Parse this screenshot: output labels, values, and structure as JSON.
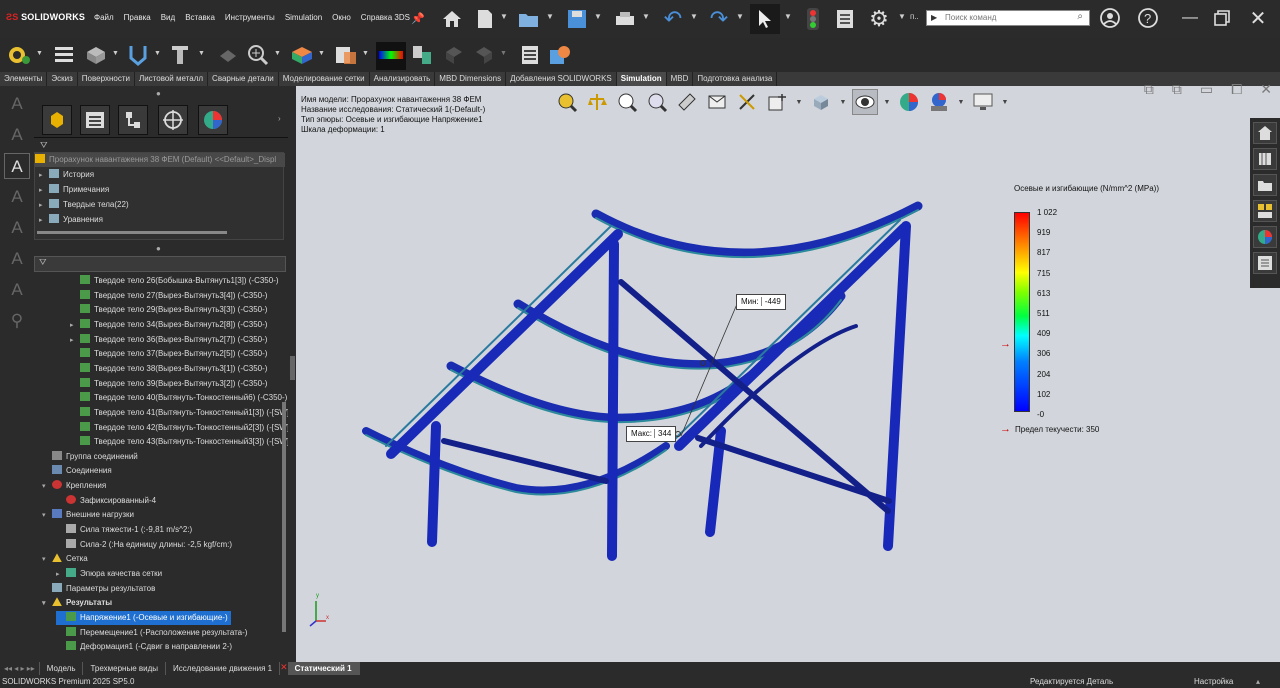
{
  "app": {
    "logo_text": "SOLIDWORKS"
  },
  "menu": [
    "Файл",
    "Правка",
    "Вид",
    "Вставка",
    "Инструменты",
    "Simulation",
    "Окно",
    "Справка 3DS"
  ],
  "top_toolbar": {
    "cut_label": "п..",
    "search_placeholder": "Поиск команд"
  },
  "tabs": [
    {
      "label": "Элементы",
      "active": false
    },
    {
      "label": "Эскиз",
      "active": false
    },
    {
      "label": "Поверхности",
      "active": false
    },
    {
      "label": "Листовой металл",
      "active": false
    },
    {
      "label": "Сварные детали",
      "active": false
    },
    {
      "label": "Моделирование сетки",
      "active": false
    },
    {
      "label": "Анализировать",
      "active": false
    },
    {
      "label": "MBD Dimensions",
      "active": false
    },
    {
      "label": "Добавления SOLIDWORKS",
      "active": false
    },
    {
      "label": "Simulation",
      "active": true
    },
    {
      "label": "MBD",
      "active": false
    },
    {
      "label": "Подготовка анализа",
      "active": false
    }
  ],
  "feature_tree_top": {
    "root": "Прорахунок навантаження 38 ФЕМ (Default) <<Default>_Displ",
    "items": [
      "История",
      "Примечания",
      "Твердые тела(22)",
      "Уравнения"
    ]
  },
  "feature_tree_bottom": {
    "items": [
      {
        "label": "Твердое тело 26(Бобышка-Вытянуть1[3]) (-C350-)",
        "indent": 3,
        "icon": "body",
        "arrow": false
      },
      {
        "label": "Твердое тело 27(Вырез-Вытянуть3[4]) (-C350-)",
        "indent": 3,
        "icon": "body",
        "arrow": false
      },
      {
        "label": "Твердое тело 29(Вырез-Вытянуть3[3]) (-C350-)",
        "indent": 3,
        "icon": "body",
        "arrow": false
      },
      {
        "label": "Твердое тело 34(Вырез-Вытянуть2[8]) (-C350-)",
        "indent": 3,
        "icon": "body",
        "arrow": true
      },
      {
        "label": "Твердое тело 36(Вырез-Вытянуть2[7]) (-C350-)",
        "indent": 3,
        "icon": "body",
        "arrow": true
      },
      {
        "label": "Твердое тело 37(Вырез-Вытянуть2[5]) (-C350-)",
        "indent": 3,
        "icon": "body",
        "arrow": false
      },
      {
        "label": "Твердое тело 38(Вырез-Вытянуть3[1]) (-C350-)",
        "indent": 3,
        "icon": "body",
        "arrow": false
      },
      {
        "label": "Твердое тело 39(Вырез-Вытянуть3[2]) (-C350-)",
        "indent": 3,
        "icon": "body",
        "arrow": false
      },
      {
        "label": "Твердое тело 40(Вытянуть-Тонкостенный6) (-C350-)",
        "indent": 3,
        "icon": "body",
        "arrow": false
      },
      {
        "label": "Твердое тело 41(Вытянуть-Тонкостенный1[3]) (-[SW]",
        "indent": 3,
        "icon": "body",
        "arrow": false
      },
      {
        "label": "Твердое тело 42(Вытянуть-Тонкостенный2[3]) (-[SW]",
        "indent": 3,
        "icon": "body",
        "arrow": false
      },
      {
        "label": "Твердое тело 43(Вытянуть-Тонкостенный3[3]) (-[SW]",
        "indent": 3,
        "icon": "body",
        "arrow": false
      },
      {
        "label": "Группа соединений",
        "indent": 1,
        "icon": "group",
        "arrow": false
      },
      {
        "label": "Соединения",
        "indent": 1,
        "icon": "conn",
        "arrow": false
      },
      {
        "label": "Крепления",
        "indent": 1,
        "icon": "fix",
        "arrow": true
      },
      {
        "label": "Зафиксированный-4",
        "indent": 2,
        "icon": "fixred",
        "arrow": false
      },
      {
        "label": "Внешние нагрузки",
        "indent": 1,
        "icon": "load",
        "arrow": true
      },
      {
        "label": "Сила тяжести-1 (:-9,81 m/s^2:)",
        "indent": 2,
        "icon": "grav",
        "arrow": false
      },
      {
        "label": "Сила-2 (:На единицу длины: -2,5 kgf/cm:)",
        "indent": 2,
        "icon": "force",
        "arrow": false
      },
      {
        "label": "Сетка",
        "indent": 1,
        "icon": "warn",
        "arrow": true
      },
      {
        "label": "Эпюра качества сетки",
        "indent": 2,
        "icon": "plot",
        "arrow": true
      },
      {
        "label": "Параметры результатов",
        "indent": 1,
        "icon": "params",
        "arrow": false
      },
      {
        "label": "Результаты",
        "indent": 1,
        "icon": "warn",
        "arrow": true,
        "bold": true
      },
      {
        "label": "Напряжение1 (-Осевые и изгибающие-)",
        "indent": 2,
        "icon": "res",
        "arrow": false,
        "selected": true
      },
      {
        "label": "Перемещение1 (-Расположение результата-)",
        "indent": 2,
        "icon": "res",
        "arrow": false
      },
      {
        "label": "Деформация1 (-Сдвиг в направлении 2-)",
        "indent": 2,
        "icon": "res",
        "arrow": false
      }
    ]
  },
  "model_info": [
    "Имя модели: Прорахунок навантаження 38 ФЕМ",
    "Название исследования: Статический 1(-Default-)",
    "Тип эпюры: Осевые и изгибающие Напряжение1",
    "Шкала деформации: 1"
  ],
  "legend": {
    "title": "Осевые и изгибающие (N/mm^2 (MPa))",
    "ticks": [
      "1 022",
      "919",
      "817",
      "715",
      "613",
      "511",
      "409",
      "306",
      "204",
      "102",
      "-0"
    ],
    "yield_label": "Предел текучести: 350"
  },
  "probes": {
    "min_label": "Мин:",
    "min_value": "-449",
    "max_label": "Макс:",
    "max_value": "344"
  },
  "axes_triad": {
    "x": "x",
    "y": "y"
  },
  "bottom_tabs": [
    {
      "label": "Модель",
      "active": false
    },
    {
      "label": "Трехмерные виды",
      "active": false
    },
    {
      "label": "Исследование движения 1",
      "active": false
    },
    {
      "label": "Статический 1",
      "active": true
    }
  ],
  "status": {
    "left": "SOLIDWORKS Premium 2025 SP5.0",
    "middle": "Редактируется Деталь",
    "right": "Настройка"
  }
}
